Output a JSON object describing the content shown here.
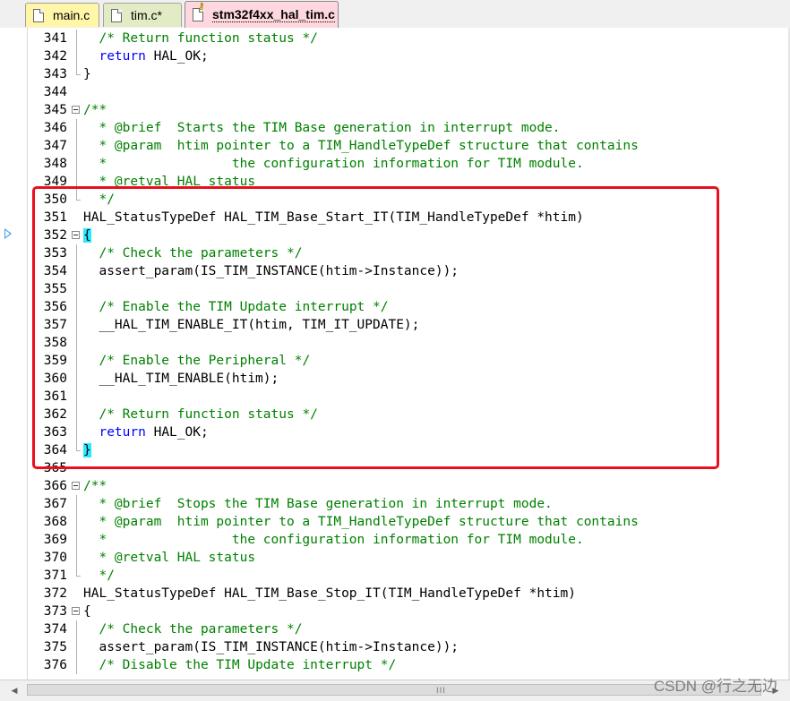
{
  "tabs": [
    {
      "label": "main.c",
      "active": false
    },
    {
      "label": "tim.c*",
      "active": false
    },
    {
      "label": "stm32f4xx_hal_tim.c",
      "active": true
    }
  ],
  "colors": {
    "comment": "#008000",
    "keyword": "#0000ff",
    "brace_highlight": "#29e8ff",
    "highlight_box": "#e8101c",
    "tab_main": "#fff6a8",
    "tab_tim": "#e2ecc4",
    "tab_active": "#ffd7df"
  },
  "lines": [
    {
      "n": "341",
      "fold": "vline",
      "tokens": [
        {
          "t": "  "
        },
        {
          "t": "/* Return function status */",
          "c": "comment"
        }
      ]
    },
    {
      "n": "342",
      "fold": "vline",
      "tokens": [
        {
          "t": "  "
        },
        {
          "t": "return",
          "c": "keyword"
        },
        {
          "t": " HAL_OK;"
        }
      ]
    },
    {
      "n": "343",
      "fold": "end",
      "tokens": [
        {
          "t": "}"
        }
      ]
    },
    {
      "n": "344",
      "fold": "none",
      "tokens": []
    },
    {
      "n": "345",
      "fold": "box",
      "tokens": [
        {
          "t": "/**",
          "c": "comment"
        }
      ]
    },
    {
      "n": "346",
      "fold": "vline",
      "tokens": [
        {
          "t": "  * @brief  Starts the TIM Base generation in interrupt mode.",
          "c": "comment"
        }
      ]
    },
    {
      "n": "347",
      "fold": "vline",
      "tokens": [
        {
          "t": "  * @param  htim pointer to a TIM_HandleTypeDef structure that contains",
          "c": "comment"
        }
      ]
    },
    {
      "n": "348",
      "fold": "vline",
      "tokens": [
        {
          "t": "  *                the configuration information for TIM module.",
          "c": "comment"
        }
      ]
    },
    {
      "n": "349",
      "fold": "vline",
      "tokens": [
        {
          "t": "  * @retval HAL status",
          "c": "comment"
        }
      ]
    },
    {
      "n": "350",
      "fold": "end",
      "tokens": [
        {
          "t": "  */",
          "c": "comment"
        }
      ]
    },
    {
      "n": "351",
      "fold": "none",
      "tokens": [
        {
          "t": "HAL_StatusTypeDef HAL_TIM_Base_Start_IT(TIM_HandleTypeDef *htim)"
        }
      ]
    },
    {
      "n": "352",
      "fold": "box",
      "tokens": [
        {
          "t": "{",
          "c": "brace"
        }
      ]
    },
    {
      "n": "353",
      "fold": "vline",
      "tokens": [
        {
          "t": "  "
        },
        {
          "t": "/* Check the parameters */",
          "c": "comment"
        }
      ]
    },
    {
      "n": "354",
      "fold": "vline",
      "tokens": [
        {
          "t": "  assert_param(IS_TIM_INSTANCE(htim->Instance));"
        }
      ]
    },
    {
      "n": "355",
      "fold": "vline",
      "tokens": []
    },
    {
      "n": "356",
      "fold": "vline",
      "tokens": [
        {
          "t": "  "
        },
        {
          "t": "/* Enable the TIM Update interrupt */",
          "c": "comment"
        }
      ]
    },
    {
      "n": "357",
      "fold": "vline",
      "tokens": [
        {
          "t": "  __HAL_TIM_ENABLE_IT(htim, TIM_IT_UPDATE);"
        }
      ]
    },
    {
      "n": "358",
      "fold": "vline",
      "tokens": []
    },
    {
      "n": "359",
      "fold": "vline",
      "tokens": [
        {
          "t": "  "
        },
        {
          "t": "/* Enable the Peripheral */",
          "c": "comment"
        }
      ]
    },
    {
      "n": "360",
      "fold": "vline",
      "tokens": [
        {
          "t": "  __HAL_TIM_ENABLE(htim);"
        }
      ]
    },
    {
      "n": "361",
      "fold": "vline",
      "tokens": []
    },
    {
      "n": "362",
      "fold": "vline",
      "tokens": [
        {
          "t": "  "
        },
        {
          "t": "/* Return function status */",
          "c": "comment"
        }
      ]
    },
    {
      "n": "363",
      "fold": "vline",
      "tokens": [
        {
          "t": "  "
        },
        {
          "t": "return",
          "c": "keyword"
        },
        {
          "t": " HAL_OK;"
        }
      ]
    },
    {
      "n": "364",
      "fold": "end",
      "tokens": [
        {
          "t": "}",
          "c": "brace"
        }
      ]
    },
    {
      "n": "365",
      "fold": "none",
      "tokens": []
    },
    {
      "n": "366",
      "fold": "box",
      "tokens": [
        {
          "t": "/**",
          "c": "comment"
        }
      ]
    },
    {
      "n": "367",
      "fold": "vline",
      "tokens": [
        {
          "t": "  * @brief  Stops the TIM Base generation in interrupt mode.",
          "c": "comment"
        }
      ]
    },
    {
      "n": "368",
      "fold": "vline",
      "tokens": [
        {
          "t": "  * @param  htim pointer to a TIM_HandleTypeDef structure that contains",
          "c": "comment"
        }
      ]
    },
    {
      "n": "369",
      "fold": "vline",
      "tokens": [
        {
          "t": "  *                the configuration information for TIM module.",
          "c": "comment"
        }
      ]
    },
    {
      "n": "370",
      "fold": "vline",
      "tokens": [
        {
          "t": "  * @retval HAL status",
          "c": "comment"
        }
      ]
    },
    {
      "n": "371",
      "fold": "end",
      "tokens": [
        {
          "t": "  */",
          "c": "comment"
        }
      ]
    },
    {
      "n": "372",
      "fold": "none",
      "tokens": [
        {
          "t": "HAL_StatusTypeDef HAL_TIM_Base_Stop_IT(TIM_HandleTypeDef *htim)"
        }
      ]
    },
    {
      "n": "373",
      "fold": "box",
      "tokens": [
        {
          "t": "{"
        }
      ]
    },
    {
      "n": "374",
      "fold": "vline",
      "tokens": [
        {
          "t": "  "
        },
        {
          "t": "/* Check the parameters */",
          "c": "comment"
        }
      ]
    },
    {
      "n": "375",
      "fold": "vline",
      "tokens": [
        {
          "t": "  assert_param(IS_TIM_INSTANCE(htim->Instance));"
        }
      ]
    },
    {
      "n": "376",
      "fold": "vline",
      "tokens": [
        {
          "t": "  "
        },
        {
          "t": "/* Disable the TIM Update interrupt */",
          "c": "comment"
        }
      ]
    }
  ],
  "scrollbar": {
    "grip": "III"
  },
  "watermark": "CSDN @行之无边"
}
